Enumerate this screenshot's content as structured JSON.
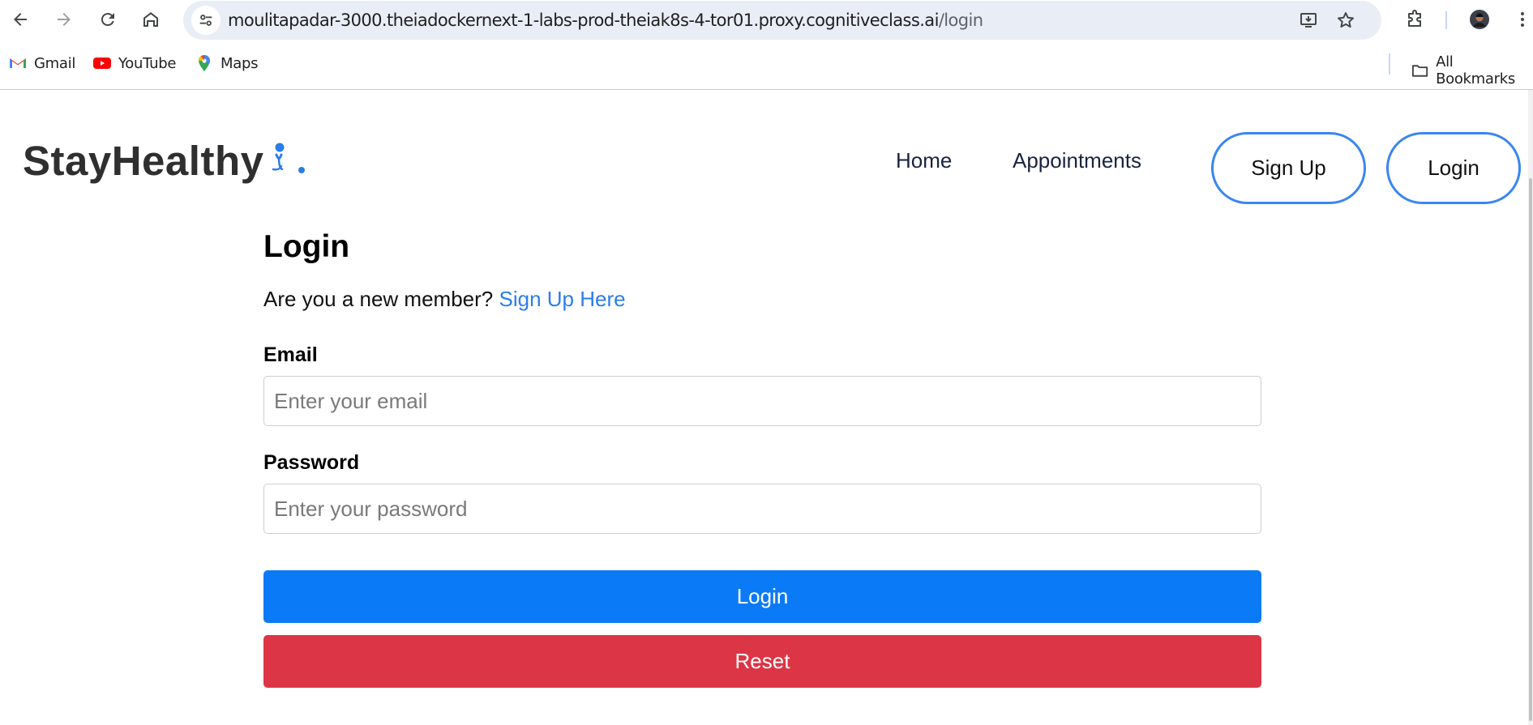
{
  "browser": {
    "url_main": "moulitapadar-3000.theiadockernext-1-labs-prod-theiak8s-4-tor01.proxy.cognitiveclass.ai",
    "url_path": "/login",
    "bookmarks": [
      {
        "label": "Gmail",
        "icon": "gmail-icon"
      },
      {
        "label": "YouTube",
        "icon": "youtube-icon"
      },
      {
        "label": "Maps",
        "icon": "maps-icon"
      }
    ],
    "all_bookmarks_label": "All Bookmarks"
  },
  "header": {
    "logo_text": "StayHealthy",
    "nav": [
      {
        "label": "Home"
      },
      {
        "label": "Appointments"
      }
    ],
    "signup_label": "Sign Up",
    "login_label": "Login"
  },
  "form": {
    "title": "Login",
    "member_prompt": "Are you a new member?",
    "signup_link": "Sign Up Here",
    "email_label": "Email",
    "email_placeholder": "Enter your email",
    "password_label": "Password",
    "password_placeholder": "Enter your password",
    "login_button": "Login",
    "reset_button": "Reset"
  },
  "colors": {
    "accent_blue": "#0b7af7",
    "reset_red": "#dc3545",
    "link_blue": "#2b7de9",
    "pill_border": "#3a86f0"
  }
}
